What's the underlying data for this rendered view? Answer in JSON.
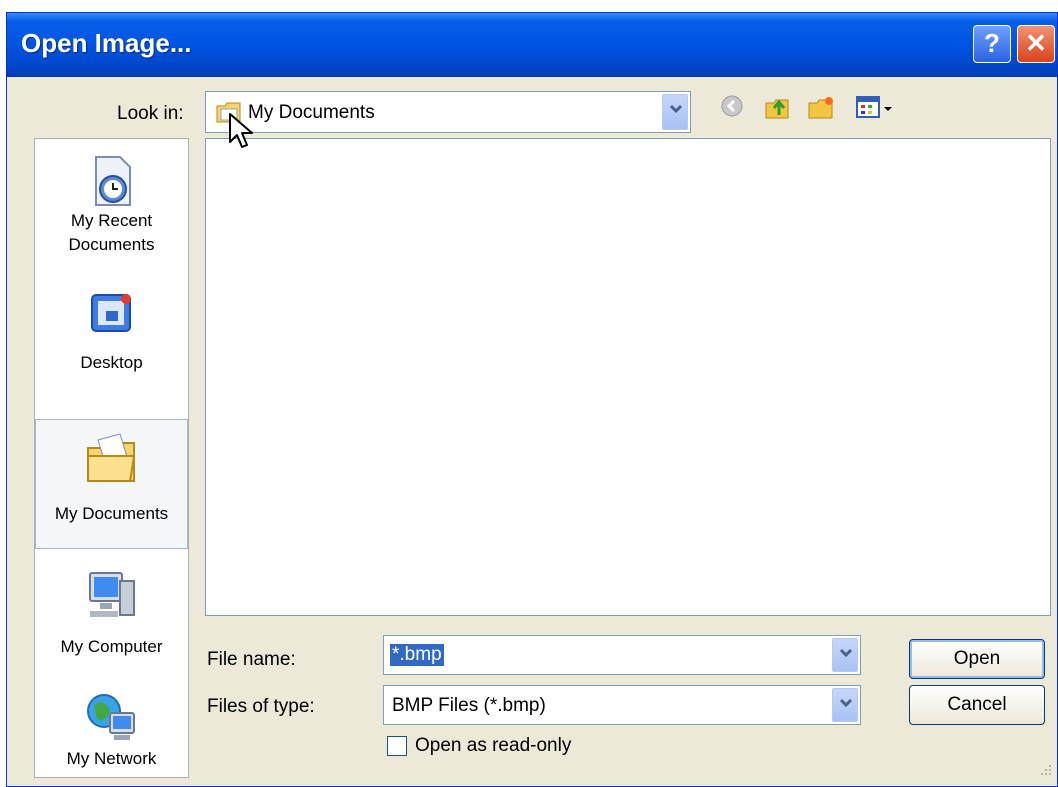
{
  "window": {
    "title": "Open Image..."
  },
  "look_in": {
    "label": "Look in:",
    "value": "My Documents"
  },
  "places": [
    {
      "label_line1": "My Recent",
      "label_line2": "Documents"
    },
    {
      "label_line1": "Desktop",
      "label_line2": ""
    },
    {
      "label_line1": "My Documents",
      "label_line2": ""
    },
    {
      "label_line1": "My Computer",
      "label_line2": ""
    },
    {
      "label_line1": "My Network",
      "label_line2": ""
    }
  ],
  "file_name": {
    "label": "File name:",
    "value": "*.bmp"
  },
  "file_type": {
    "label": "Files of type:",
    "value": "BMP Files (*.bmp)"
  },
  "read_only": {
    "label": "Open as read-only",
    "checked": false
  },
  "buttons": {
    "open": "Open",
    "cancel": "Cancel"
  },
  "titlebar_buttons": {
    "help": "?",
    "close": "✕"
  },
  "colors": {
    "titlebar": "#0054e3",
    "dialog_bg": "#ece9d8",
    "selection": "#316ac5"
  }
}
